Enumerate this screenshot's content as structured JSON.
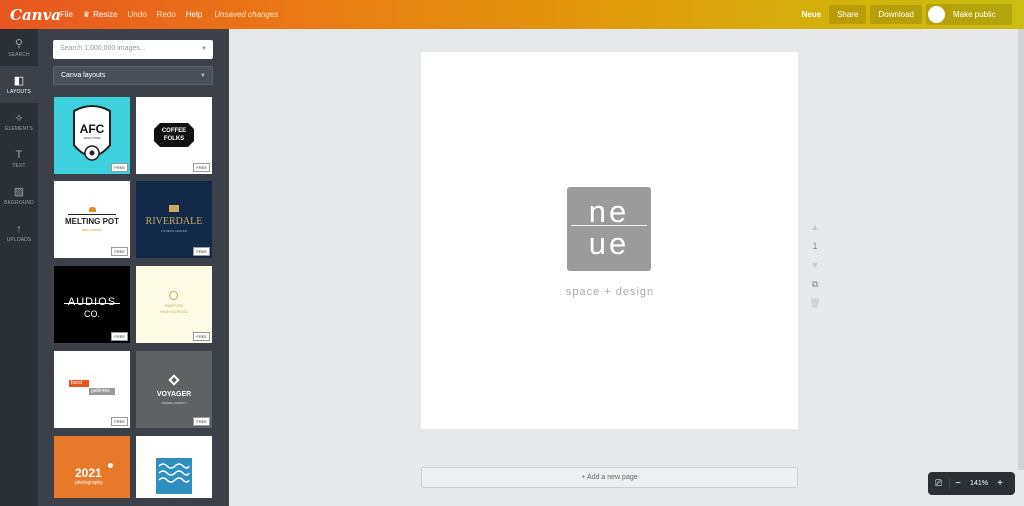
{
  "topbar": {
    "logo": "Canva",
    "menu": [
      "File",
      "Resize",
      "Undo",
      "Redo",
      "Help"
    ],
    "status": "Unsaved changes",
    "design_name": "Neue",
    "share_label": "Share",
    "download_label": "Download",
    "make_public_label": "Make public"
  },
  "rail": {
    "items": [
      {
        "label": "SEARCH",
        "icon": "search-icon"
      },
      {
        "label": "LAYOUTS",
        "icon": "layouts-icon"
      },
      {
        "label": "ELEMENTS",
        "icon": "elements-icon"
      },
      {
        "label": "TEXT",
        "icon": "text-icon"
      },
      {
        "label": "BKGROUND",
        "icon": "background-icon"
      },
      {
        "label": "UPLOADS",
        "icon": "uploads-icon"
      }
    ]
  },
  "panel": {
    "search_placeholder": "Search 1,000,000 images...",
    "dropdown_value": "Canva layouts",
    "free_badge": "FREE",
    "tiles": {
      "t1_line1": "AFC",
      "t1_line2": "WOLFTONE",
      "t2_line1": "COFFEE",
      "t2_line2": "FOLKS",
      "t3_line1": "MELTING POT",
      "t3_line2": "RESTAURANT",
      "t4_line1": "RIVERDALE",
      "t4_line2": "FITNESS CENTER",
      "t5_line1": "AUDIOS",
      "t5_line2": "CO.",
      "t6_line1": "SWIFTON",
      "t6_line2": "HIGH SCHOOL",
      "t7_line1": "burst",
      "t7_line2": "galleries",
      "t8_line1": "VOYAGER",
      "t8_line2": "TRAVEL AGENCY",
      "t9_line1": "2021",
      "t9_line2": "photography"
    }
  },
  "canvas": {
    "logo_top": "ne",
    "logo_bottom": "ue",
    "tagline": "space + design",
    "page_number": "1",
    "add_page": "+ Add a new page"
  },
  "zoom": {
    "value": "141%",
    "minus": "−",
    "plus": "+"
  }
}
